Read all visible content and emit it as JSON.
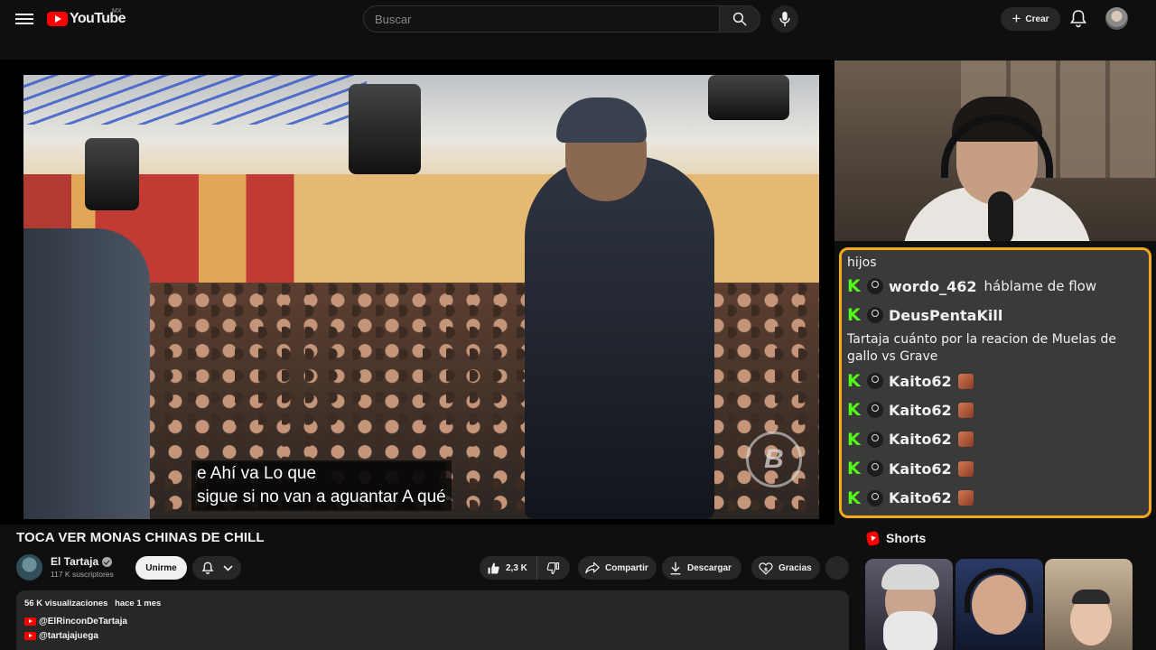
{
  "header": {
    "logo_text": "YouTube",
    "country_code": "MX",
    "search_placeholder": "Buscar",
    "create_label": "Crear"
  },
  "video": {
    "subtitle_line1": "e Ahí va Lo que",
    "subtitle_line2": "sigue si no van a aguantar A qué",
    "watermark": "B",
    "title": "TOCA VER MONAS CHINAS DE CHILL"
  },
  "channel": {
    "name": "El Tartaja",
    "subscribers": "117 K suscriptores",
    "join_label": "Unirme"
  },
  "actions": {
    "likes": "2,3 K",
    "share_label": "Compartir",
    "download_label": "Descargar",
    "thanks_label": "Gracias"
  },
  "description": {
    "views": "56 K visualizaciones",
    "date": "hace 1 mes",
    "links": [
      "@ElRinconDeTartaja",
      "@tartajajuega"
    ]
  },
  "chat": {
    "top_line": "hijos",
    "messages": [
      {
        "user": "wordo_462",
        "text": "háblame de flow",
        "emote": false
      },
      {
        "user": "DeusPentaKill",
        "text": "",
        "emote": false
      }
    ],
    "standalone": "Tartaja cuánto por la reacion de Muelas de gallo vs Grave",
    "repeat_messages": [
      {
        "user": "Kaito62",
        "emote": true
      },
      {
        "user": "Kaito62",
        "emote": true
      },
      {
        "user": "Kaito62",
        "emote": true
      },
      {
        "user": "Kaito62",
        "emote": true
      },
      {
        "user": "Kaito62",
        "emote": true
      }
    ],
    "badge_color": "#53fc18",
    "border_color": "#f5a91e"
  },
  "shorts": {
    "heading": "Shorts"
  },
  "colors": {
    "background": "#0f0f0f",
    "brand_red": "#ff0000",
    "chip_bg": "#272727"
  }
}
